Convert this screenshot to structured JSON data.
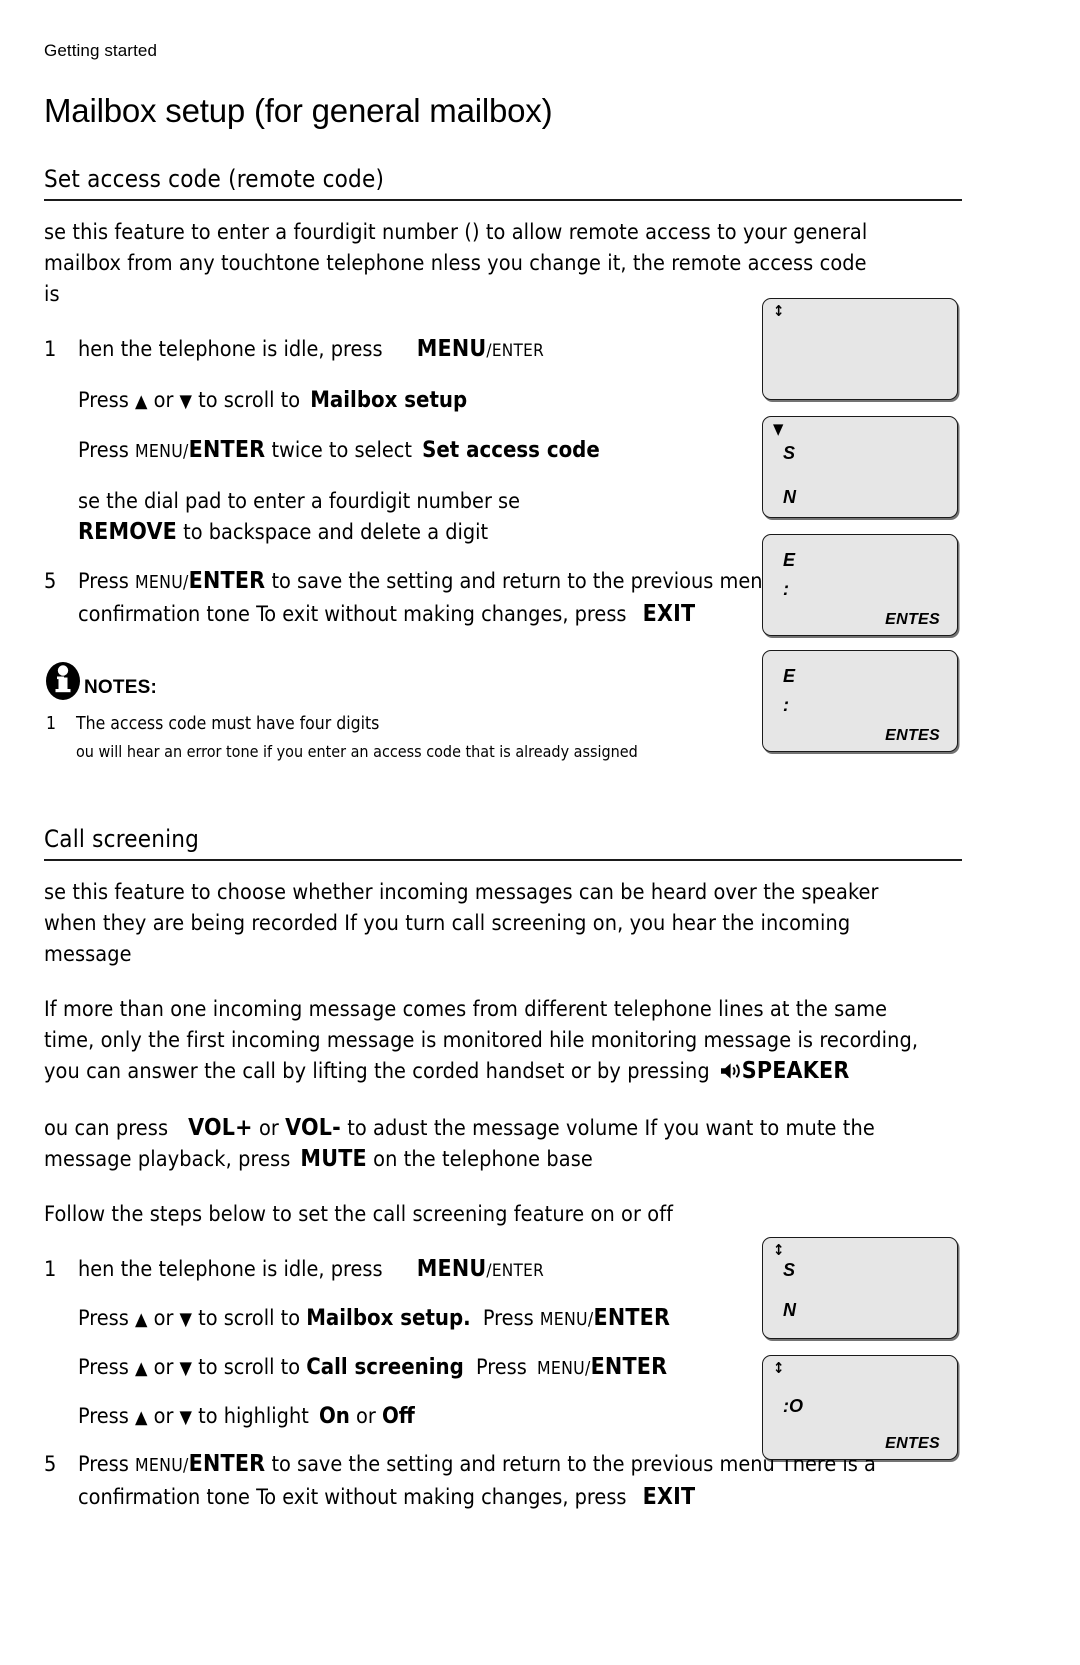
{
  "header": {
    "running_head": "Getting started",
    "page_title": "Mailbox setup (for general mailbox)"
  },
  "sections": [
    {
      "id": "set-access-code",
      "heading": "Set access code (remote code)",
      "intro": "se this feature to enter a fourdigit number () to allow remote access to your general mailbox from any touchtone telephone nless you change it, the remote access code is",
      "steps": [
        {
          "num": "1",
          "pre": "hen the telephone is idle, press",
          "key_main": "MENU",
          "key_sub": "/ENTER",
          "post": ""
        },
        {
          "num": "",
          "pre": "Press",
          "arrow_up": "▲",
          "or": "or",
          "arrow_down": "▼",
          "mid": "to scroll to",
          "lcd_term": "Mailbox setup",
          "post": ""
        },
        {
          "num": "",
          "pre": "Press",
          "key_small": "MENU/",
          "key_main": "ENTER",
          "mid": "twice  to select",
          "lcd_term": "Set access code",
          "post": ""
        },
        {
          "num": "",
          "pre": "se the dial pad to enter a fourdigit number se",
          "key_main": "REMOVE",
          "post": "to backspace and delete a digit"
        },
        {
          "num": "5",
          "pre": "Press",
          "key_small": "MENU/",
          "key_main": "ENTER",
          "mid": "to save the setting and return to the previous menu There is a confirmation tone To exit without making changes, press",
          "key_exit": "EXIT",
          "post": ""
        }
      ],
      "notes": {
        "label": "NOTES:",
        "icon": "info-icon",
        "items": [
          {
            "num": "1",
            "text": "The access code must have four digits",
            "sub": false
          },
          {
            "num": "",
            "text": "ou will hear an error tone if you enter an access code that is already assigned",
            "sub": true
          }
        ]
      },
      "lcd_screens": [
        {
          "arrow": "↕",
          "lines": [],
          "softkey": ""
        },
        {
          "arrow": "▼",
          "lines": [
            "S",
            "N"
          ],
          "softkey": ""
        },
        {
          "arrow": "",
          "lines": [
            "E",
            ":"
          ],
          "softkey": "ENTES"
        },
        {
          "arrow": "",
          "lines": [
            "E",
            ":"
          ],
          "softkey": "ENTES"
        }
      ]
    },
    {
      "id": "call-screening",
      "heading": "Call screening",
      "para1": "se this feature to choose whether incoming messages can be heard over the speaker when they are being recorded If you turn call screening on, you hear the incoming message",
      "para2": "If more than one incoming message comes from different     telephone  lines at the same time, only the first incoming message is monitored hile monitoring message is recording, you can answer the call by lifting the corded handset or by pressing",
      "para2_key": "SPEAKER",
      "para3_pre": "ou can press",
      "para3_key1": "VOL+",
      "para3_or": "or",
      "para3_key2": "VOL-",
      "para3_mid": "to adust the message volume If you want to mute the message playback, press",
      "para3_key3": "MUTE",
      "para3_post": "on the telephone base",
      "para4": "Follow the steps below to set the call screening feature on or off",
      "steps": [
        {
          "num": "1",
          "pre": "hen the telephone is idle, press",
          "key_main": "MENU",
          "key_sub": "/ENTER"
        },
        {
          "num": "",
          "pre": "Press",
          "arrow_up": "▲",
          "or": "or",
          "arrow_down": "▼",
          "mid": "to scroll to",
          "lcd_term": "Mailbox setup.",
          "tail_pre": "Press",
          "key_small": "MENU/",
          "key_main": "ENTER"
        },
        {
          "num": "",
          "pre": "Press",
          "arrow_up": "▲",
          "or": "or",
          "arrow_down": "▼",
          "mid": "to scroll to",
          "lcd_term": "Call screening",
          "tail_pre": "Press",
          "key_small": "MENU/",
          "key_main": "ENTER"
        },
        {
          "num": "",
          "pre": "Press",
          "arrow_up": "▲",
          "or": "or",
          "arrow_down": "▼",
          "mid": "to highlight",
          "lcd_term": "On",
          "or2": "or",
          "lcd_term2": "Off"
        },
        {
          "num": "5",
          "pre": "Press",
          "key_small": "MENU/",
          "key_main": "ENTER",
          "mid": "to save the setting and return to the previous menu There is a confirmation tone To exit without making changes, press",
          "key_exit": "EXIT"
        }
      ],
      "lcd_screens": [
        {
          "arrow": "↕",
          "lines": [
            "S",
            "N"
          ],
          "softkey": ""
        },
        {
          "arrow": "↕",
          "lines": [
            ":O"
          ],
          "softkey": "ENTES"
        }
      ]
    }
  ],
  "colors": {
    "lcd_fill": "#e6e6e6",
    "lcd_border": "#1a1a1a",
    "rule": "#1b1b1b",
    "text": "#000000"
  }
}
